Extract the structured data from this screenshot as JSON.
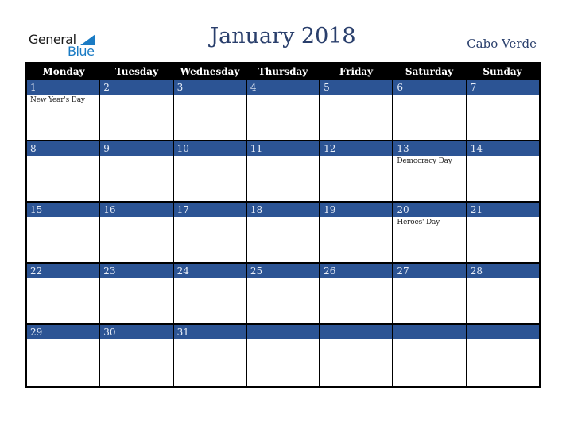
{
  "logo": {
    "line1": "General",
    "line2": "Blue"
  },
  "header": {
    "title": "January 2018",
    "country": "Cabo Verde"
  },
  "colors": {
    "accent": "#2c5494",
    "header_bg": "#000000",
    "title": "#2a3f6c",
    "logo_blue": "#1a7bc4"
  },
  "weekdays": [
    "Monday",
    "Tuesday",
    "Wednesday",
    "Thursday",
    "Friday",
    "Saturday",
    "Sunday"
  ],
  "weeks": [
    [
      {
        "day": "1",
        "event": "New Year's Day"
      },
      {
        "day": "2",
        "event": ""
      },
      {
        "day": "3",
        "event": ""
      },
      {
        "day": "4",
        "event": ""
      },
      {
        "day": "5",
        "event": ""
      },
      {
        "day": "6",
        "event": ""
      },
      {
        "day": "7",
        "event": ""
      }
    ],
    [
      {
        "day": "8",
        "event": ""
      },
      {
        "day": "9",
        "event": ""
      },
      {
        "day": "10",
        "event": ""
      },
      {
        "day": "11",
        "event": ""
      },
      {
        "day": "12",
        "event": ""
      },
      {
        "day": "13",
        "event": "Democracy Day"
      },
      {
        "day": "14",
        "event": ""
      }
    ],
    [
      {
        "day": "15",
        "event": ""
      },
      {
        "day": "16",
        "event": ""
      },
      {
        "day": "17",
        "event": ""
      },
      {
        "day": "18",
        "event": ""
      },
      {
        "day": "19",
        "event": ""
      },
      {
        "day": "20",
        "event": "Heroes' Day"
      },
      {
        "day": "21",
        "event": ""
      }
    ],
    [
      {
        "day": "22",
        "event": ""
      },
      {
        "day": "23",
        "event": ""
      },
      {
        "day": "24",
        "event": ""
      },
      {
        "day": "25",
        "event": ""
      },
      {
        "day": "26",
        "event": ""
      },
      {
        "day": "27",
        "event": ""
      },
      {
        "day": "28",
        "event": ""
      }
    ],
    [
      {
        "day": "29",
        "event": ""
      },
      {
        "day": "30",
        "event": ""
      },
      {
        "day": "31",
        "event": ""
      },
      {
        "day": "",
        "event": ""
      },
      {
        "day": "",
        "event": ""
      },
      {
        "day": "",
        "event": ""
      },
      {
        "day": "",
        "event": ""
      }
    ]
  ]
}
